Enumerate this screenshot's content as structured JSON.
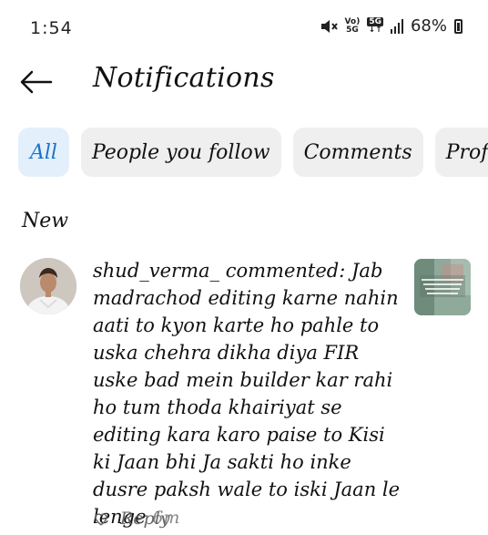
{
  "status_bar": {
    "time": "1:54",
    "battery": "68%",
    "net_top": "Vo)",
    "net_bottom": "5G",
    "net2_top": "5G",
    "icons": [
      "mute-icon",
      "volte-icon",
      "5g-icon",
      "signal-icon",
      "battery-icon"
    ]
  },
  "header": {
    "title": "Notifications",
    "back_icon": "arrow-left-icon"
  },
  "filters": [
    {
      "label": "All",
      "active": true
    },
    {
      "label": "People you follow",
      "active": false
    },
    {
      "label": "Comments",
      "active": false
    },
    {
      "label": "Profess",
      "active": false
    }
  ],
  "section": {
    "title": "New"
  },
  "notification": {
    "username": "shud_verma_",
    "action": "commented:",
    "comment": "Jab madrachod editing karne nahin aati to kyon karte ho pahle to uska chehra dikha diya FIR uske bad mein builder kar rahi ho tum thoda khairiyat se editing kara karo paise to Kisi ki Jaan bhi Ja sakti ho inke dusre paksh wale to iski Jaan le lenge",
    "time": "6m",
    "reply_label": "Reply"
  },
  "colors": {
    "accent": "#1a73c8",
    "chip_active_bg": "#e3f0fb",
    "chip_bg": "#efefef",
    "muted": "#888888"
  }
}
